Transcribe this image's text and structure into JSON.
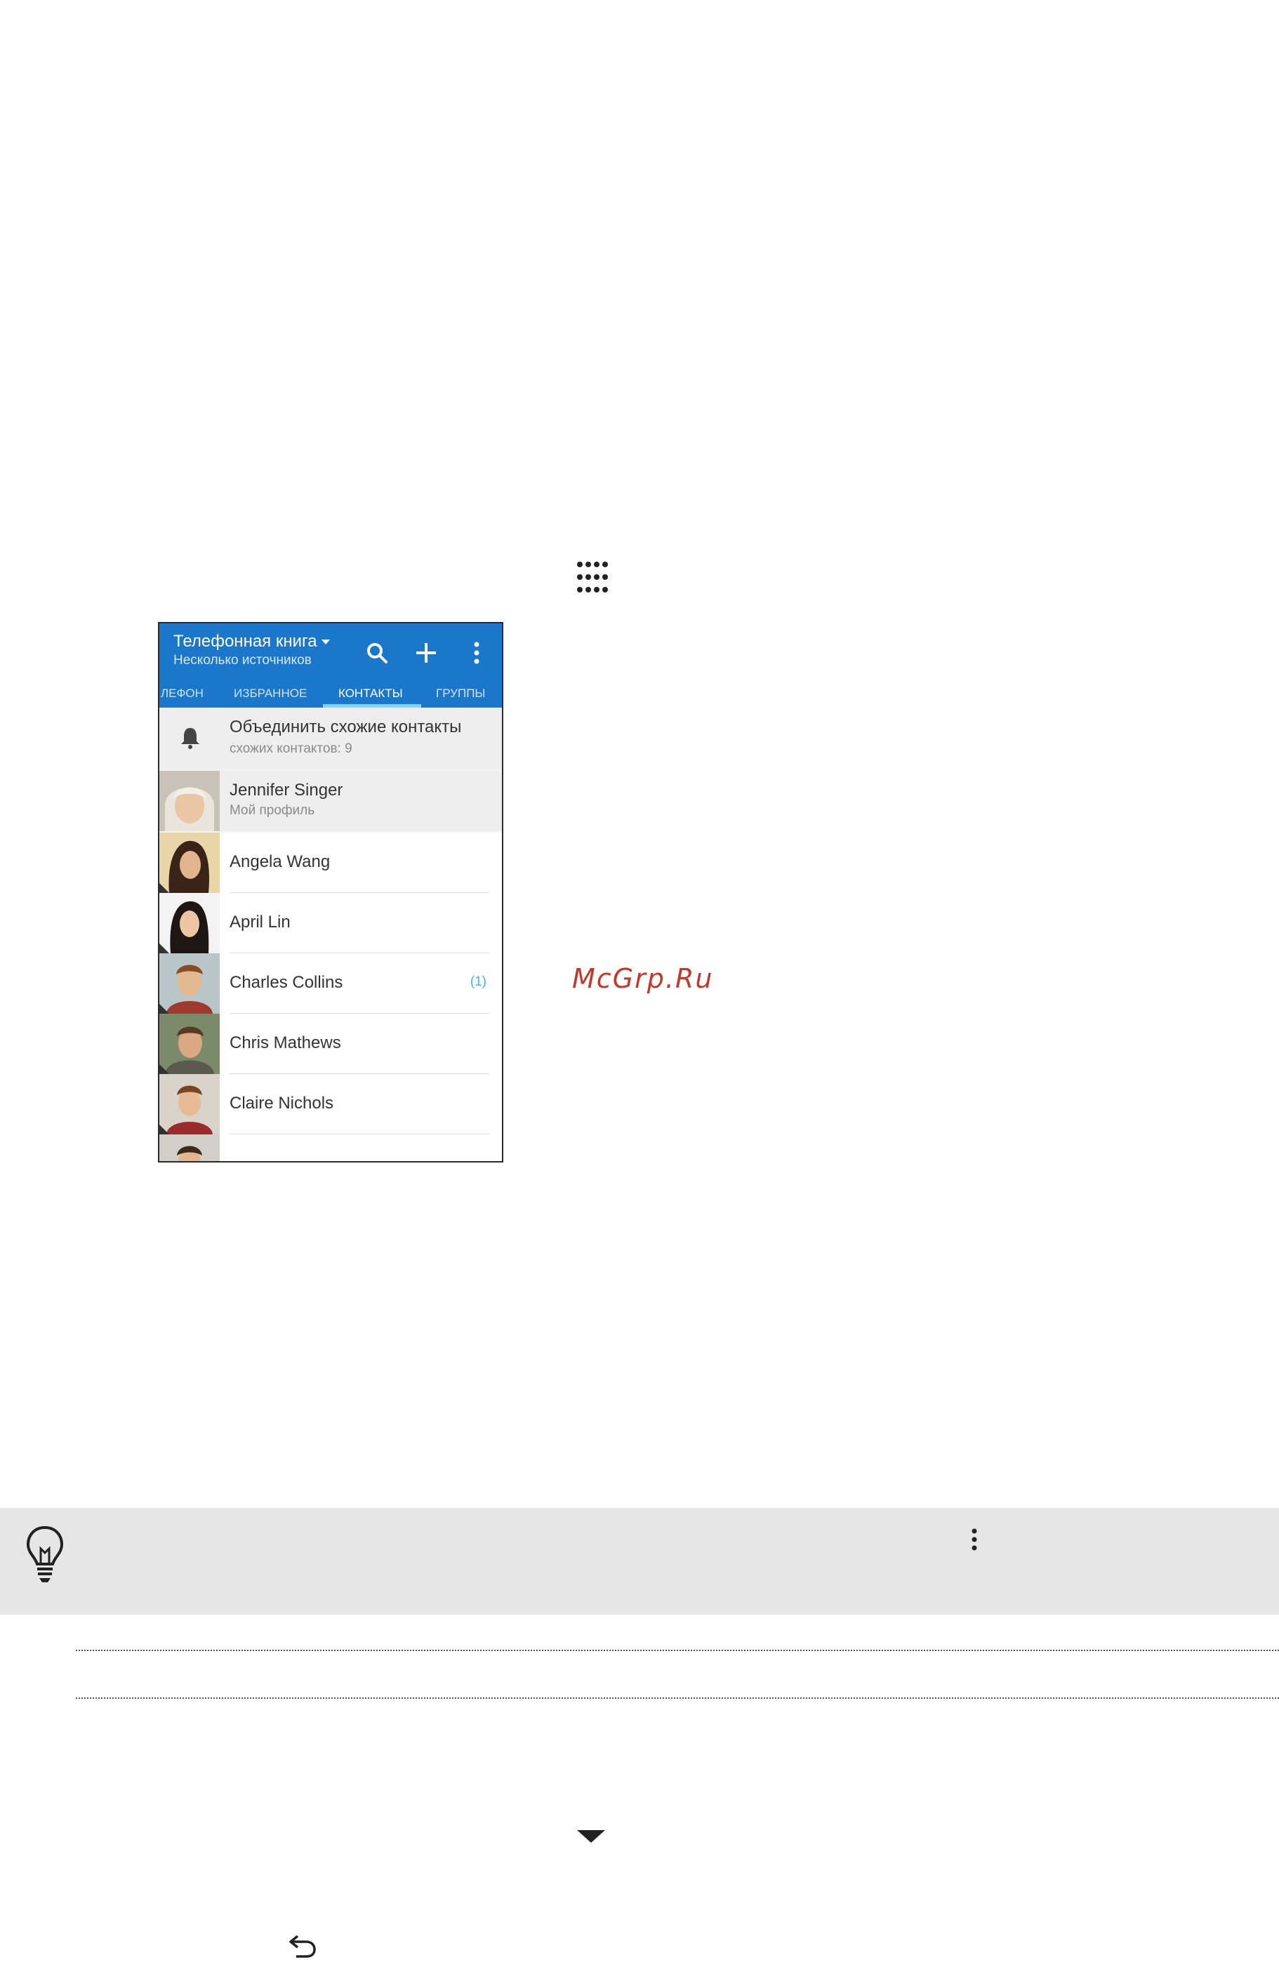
{
  "icons": {
    "apps": "apps-grid-icon",
    "tip": "lightbulb-icon",
    "more": "kebab-icon",
    "caret": "caret-down-icon",
    "back": "back-icon"
  },
  "colors": {
    "appbar": "#1b77c9",
    "tab_underline": "#7fd3f7",
    "badge": "#3fb6e8",
    "watermark": "#c0392b",
    "tip_bg": "#e6e6e6"
  },
  "phone": {
    "title": "Телефонная книга",
    "subtitle": "Несколько источников",
    "tabs": [
      "ЛЕФОН",
      "ИЗБРАННОЕ",
      "КОНТАКТЫ",
      "ГРУППЫ"
    ],
    "active_tab": "КОНТАКТЫ",
    "merge": {
      "title": "Объединить схожие контакты",
      "subtitle": "схожих контактов: 9"
    },
    "profile": {
      "name": "Jennifer Singer",
      "subtitle": "Мой профиль"
    },
    "contacts": [
      {
        "name": "Angela Wang",
        "badge": ""
      },
      {
        "name": "April Lin",
        "badge": ""
      },
      {
        "name": "Charles Collins",
        "badge": "(1)"
      },
      {
        "name": "Chris Mathews",
        "badge": ""
      },
      {
        "name": "Claire Nichols",
        "badge": ""
      }
    ]
  },
  "watermark": "McGrp.Ru"
}
